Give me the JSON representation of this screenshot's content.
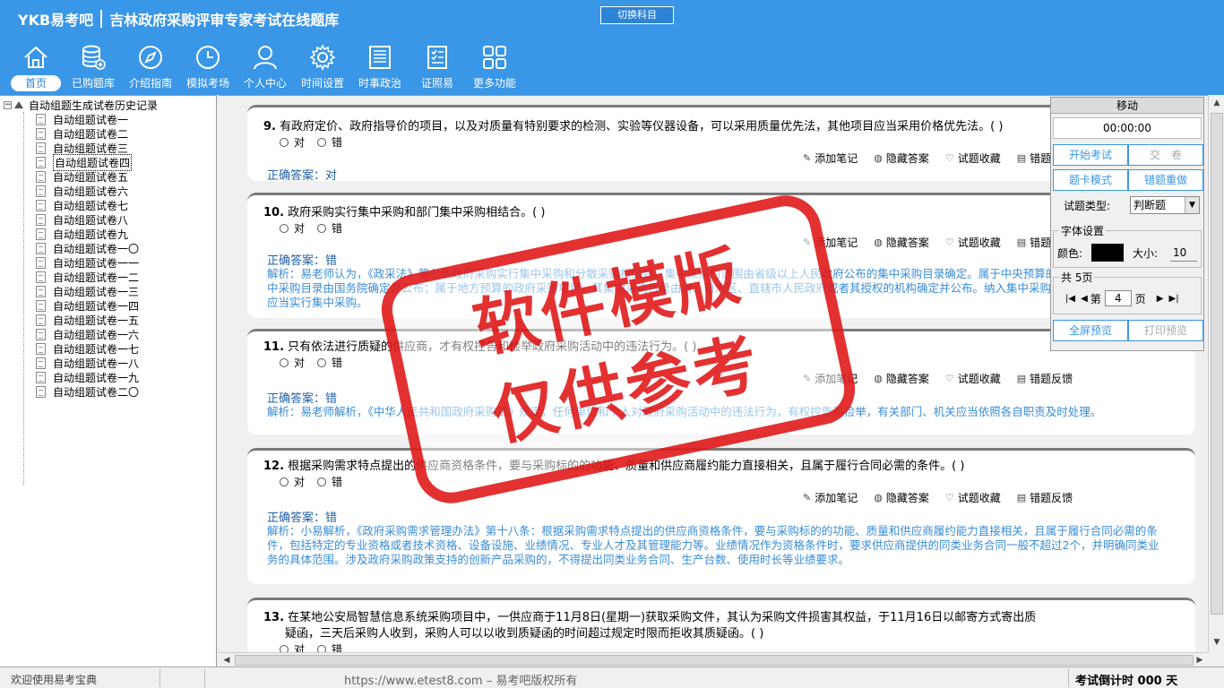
{
  "header": {
    "brand": "YKB易考吧",
    "subtitle": "吉林政府采购评审专家考试在线题库",
    "switch_label": "切换科目",
    "tools": [
      {
        "label": "首页",
        "icon": "home-icon"
      },
      {
        "label": "已购题库",
        "icon": "database-icon"
      },
      {
        "label": "介绍指南",
        "icon": "compass-icon"
      },
      {
        "label": "模拟考场",
        "icon": "clock-icon"
      },
      {
        "label": "个人中心",
        "icon": "user-icon"
      },
      {
        "label": "时间设置",
        "icon": "gear-icon"
      },
      {
        "label": "时事政治",
        "icon": "news-icon"
      },
      {
        "label": "证照易",
        "icon": "certificate-icon"
      },
      {
        "label": "更多功能",
        "icon": "grid-icon"
      }
    ]
  },
  "tree": {
    "root": "自动组题生成试卷历史记录",
    "items": [
      "自动组题试卷一",
      "自动组题试卷二",
      "自动组题试卷三",
      "自动组题试卷四",
      "自动组题试卷五",
      "自动组题试卷六",
      "自动组题试卷七",
      "自动组题试卷八",
      "自动组题试卷九",
      "自动组题试卷一〇",
      "自动组题试卷一一",
      "自动组题试卷一二",
      "自动组题试卷一三",
      "自动组题试卷一四",
      "自动组题试卷一五",
      "自动组题试卷一六",
      "自动组题试卷一七",
      "自动组题试卷一八",
      "自动组题试卷一九",
      "自动组题试卷二〇"
    ]
  },
  "questions": [
    {
      "num": "9.",
      "text": "有政府定价、政府指导价的项目，以及对质量有特别要求的检测、实验等仪器设备，可以采用质量优先法，其他项目应当采用价格优先法。( )",
      "opt_a": "对",
      "opt_b": "错",
      "answer": "正确答案：对",
      "analysis": ""
    },
    {
      "num": "10.",
      "text": "政府采购实行集中采购和部门集中采购相结合。( )",
      "opt_a": "对",
      "opt_b": "错",
      "answer": "正确答案：错",
      "analysis": "解析：易老师认为，《政采法》第七条政府采购实行集中采购和分散采购相结合。集中采购的范围由省级以上人民政府公布的集中采购目录确定。属于中央预算的政府采购项目，其集中采购目录由国务院确定并公布；属于地方预算的政府采购项目，其集中采购目录由省、自治区、直辖市人民政府或者其授权的机构确定并公布。纳入集中采购目录的政府采购项目，应当实行集中采购。"
    },
    {
      "num": "11.",
      "text": "只有依法进行质疑的供应商，才有权控告和检举政府采购活动中的违法行为。( )",
      "opt_a": "对",
      "opt_b": "错",
      "answer": "正确答案：错",
      "analysis": "解析：易老师解析，《中华人民共和国政府采购法》规定，任何单位和个人对政府采购活动中的违法行为，有权控告和检举，有关部门、机关应当依照各自职责及时处理。"
    },
    {
      "num": "12.",
      "text": "根据采购需求特点提出的供应商资格条件，要与采购标的的功能、质量和供应商履约能力直接相关，且属于履行合同必需的条件。( )",
      "opt_a": "对",
      "opt_b": "错",
      "answer": "正确答案：错",
      "analysis": "解析：小易解析，《政府采购需求管理办法》第十八条：根据采购需求特点提出的供应商资格条件，要与采购标的的功能、质量和供应商履约能力直接相关，且属于履行合同必需的条件，包括特定的专业资格或者技术资格、设备设施、业绩情况、专业人才及其管理能力等。业绩情况作为资格条件时，要求供应商提供的同类业务合同一般不超过2个，并明确同类业务的具体范围。涉及政府采购政策支持的创新产品采购的，不得提出同类业务合同、生产台数、使用时长等业绩要求。"
    },
    {
      "num": "13.",
      "text": "在某地公安局智慧信息系统采购项目中，一供应商于11月8日(星期一)获取采购文件，其认为采购文件损害其权益，于11月16日以邮寄方式寄出质",
      "text2": "疑函，三天后采购人收到，采购人可以以收到质疑函的时间超过规定时限而拒收其质疑函。( )",
      "opt_a": "对",
      "opt_b": "错",
      "answer": "",
      "analysis": ""
    }
  ],
  "actions": {
    "note": "添加笔记",
    "hide": "隐藏答案",
    "fav": "试题收藏",
    "feedback": "错题反馈"
  },
  "panel": {
    "title": "移动",
    "timer": "00:00:00",
    "start": "开始考试",
    "submit": "交　卷",
    "card_mode": "题卡模式",
    "redo": "错题重做",
    "type_label": "试题类型:",
    "type_value": "判断题",
    "font_title": "字体设置",
    "color_label": "颜色:",
    "size_label": "大小:",
    "size_value": "10",
    "pages_title": "共 5页",
    "page_prefix": "第",
    "page_value": "4",
    "page_suffix": "页",
    "fullscreen": "全屏预览",
    "print": "打印预览"
  },
  "status": {
    "welcome": "欢迎使用易考宝典",
    "site": "https://www.etest8.com – 易考吧版权所有",
    "countdown": "考试倒计时 000 天"
  },
  "stamp": {
    "line1": "软件模版",
    "line2": "仅供参考"
  },
  "colors": {
    "header_blue": "#3a96e6",
    "answer_blue": "#1f5fa8",
    "analysis_blue": "#3a8dd6",
    "stamp_red": "#e01b1b"
  }
}
